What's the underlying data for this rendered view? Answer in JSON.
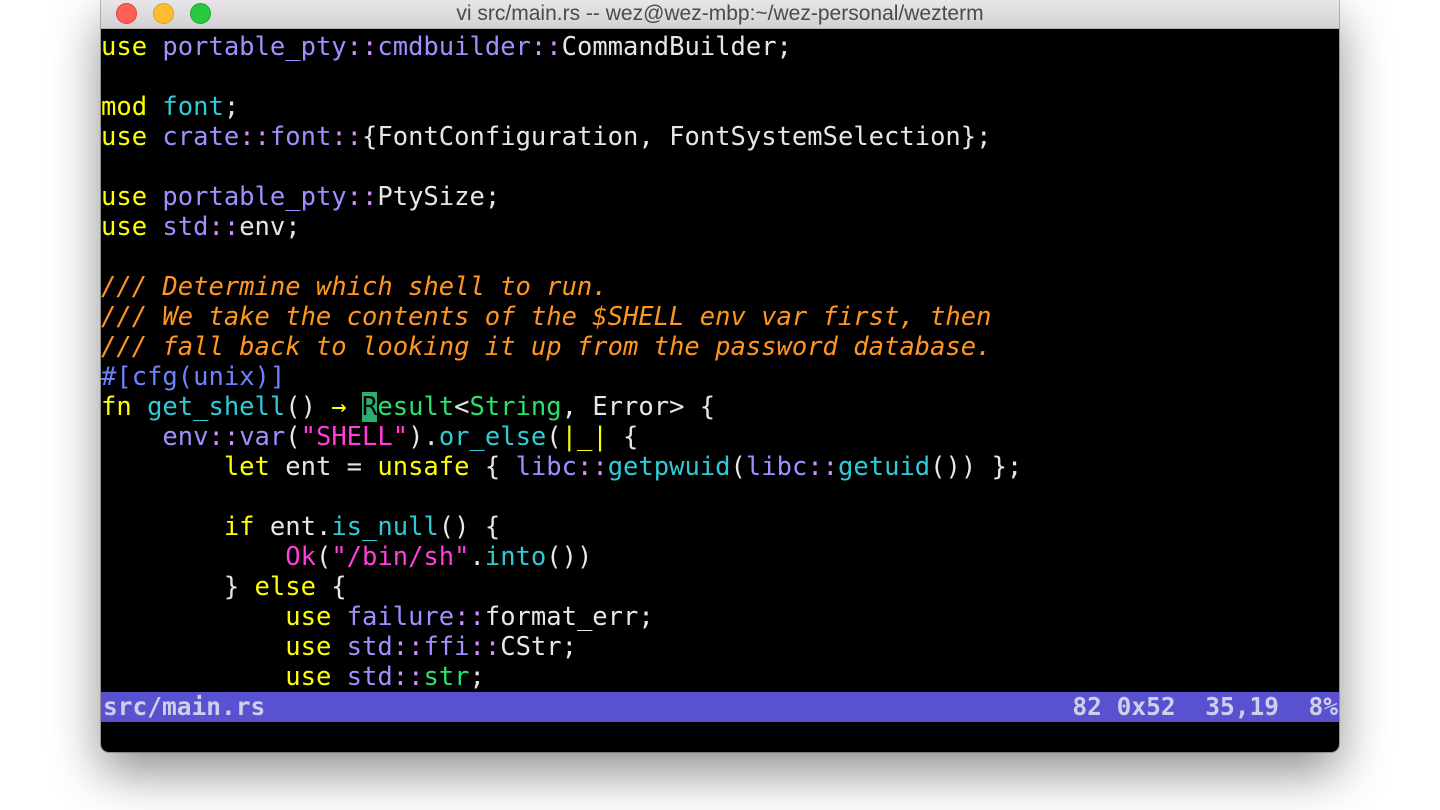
{
  "window": {
    "title": "vi src/main.rs -- wez@wez-mbp:~/wez-personal/wezterm"
  },
  "colors": {
    "keyword": "#ffff00",
    "path": "#9c91ff",
    "separator": "#d68dff",
    "text": "#e6e6e6",
    "module": "#2ecbd6",
    "comment": "#ff9620",
    "attribute": "#6e82ff",
    "function": "#2ecbd6",
    "type": "#29e070",
    "string": "#ff3fd9",
    "constant": "#ff3fd9",
    "cursor_bg": "#2cae6f",
    "statusbar_bg": "#5a51d0"
  },
  "editor": {
    "lines": [
      [
        [
          "keyword",
          "use "
        ],
        [
          "path",
          "portable_pty"
        ],
        [
          "separator",
          "::"
        ],
        [
          "path",
          "cmdbuilder"
        ],
        [
          "separator",
          "::"
        ],
        [
          "text",
          "CommandBuilder;"
        ]
      ],
      [],
      [
        [
          "keyword",
          "mod "
        ],
        [
          "module",
          "font"
        ],
        [
          "text",
          ";"
        ]
      ],
      [
        [
          "keyword",
          "use "
        ],
        [
          "path",
          "crate"
        ],
        [
          "separator",
          "::"
        ],
        [
          "path",
          "font"
        ],
        [
          "separator",
          "::"
        ],
        [
          "text",
          "{FontConfiguration, FontSystemSelection};"
        ]
      ],
      [],
      [
        [
          "keyword",
          "use "
        ],
        [
          "path",
          "portable_pty"
        ],
        [
          "separator",
          "::"
        ],
        [
          "text",
          "PtySize;"
        ]
      ],
      [
        [
          "keyword",
          "use "
        ],
        [
          "path",
          "std"
        ],
        [
          "separator",
          "::"
        ],
        [
          "text",
          "env;"
        ]
      ],
      [],
      [
        [
          "comment",
          "/// Determine which shell to run."
        ]
      ],
      [
        [
          "comment",
          "/// We take the contents of the $SHELL env var first, then"
        ]
      ],
      [
        [
          "comment",
          "/// fall back to looking it up from the password database."
        ]
      ],
      [
        [
          "attribute",
          "#[cfg(unix)]"
        ]
      ],
      [
        [
          "keyword",
          "fn "
        ],
        [
          "function",
          "get_shell"
        ],
        [
          "text",
          "() "
        ],
        [
          "keyword",
          "→ "
        ],
        [
          "cursor",
          "R"
        ],
        [
          "type",
          "esult"
        ],
        [
          "text",
          "<"
        ],
        [
          "type",
          "String"
        ],
        [
          "text",
          ", Error> {"
        ]
      ],
      [
        [
          "text",
          "    "
        ],
        [
          "path",
          "env"
        ],
        [
          "separator",
          "::"
        ],
        [
          "path",
          "var"
        ],
        [
          "text",
          "("
        ],
        [
          "string",
          "\"SHELL\""
        ],
        [
          "text",
          ")."
        ],
        [
          "function",
          "or_else"
        ],
        [
          "text",
          "("
        ],
        [
          "keyword",
          "|_|"
        ],
        [
          "text",
          " {"
        ]
      ],
      [
        [
          "text",
          "        "
        ],
        [
          "keyword",
          "let "
        ],
        [
          "text",
          "ent = "
        ],
        [
          "keyword",
          "unsafe"
        ],
        [
          "text",
          " { "
        ],
        [
          "path",
          "libc"
        ],
        [
          "separator",
          "::"
        ],
        [
          "function",
          "getpwuid"
        ],
        [
          "text",
          "("
        ],
        [
          "path",
          "libc"
        ],
        [
          "separator",
          "::"
        ],
        [
          "function",
          "getuid"
        ],
        [
          "text",
          "()) };"
        ]
      ],
      [],
      [
        [
          "text",
          "        "
        ],
        [
          "keyword",
          "if "
        ],
        [
          "text",
          "ent."
        ],
        [
          "function",
          "is_null"
        ],
        [
          "text",
          "() {"
        ]
      ],
      [
        [
          "text",
          "            "
        ],
        [
          "constant",
          "Ok"
        ],
        [
          "text",
          "("
        ],
        [
          "string",
          "\"/bin/sh\""
        ],
        [
          "text",
          "."
        ],
        [
          "function",
          "into"
        ],
        [
          "text",
          "())"
        ]
      ],
      [
        [
          "text",
          "        } "
        ],
        [
          "keyword",
          "else"
        ],
        [
          "text",
          " {"
        ]
      ],
      [
        [
          "text",
          "            "
        ],
        [
          "keyword",
          "use "
        ],
        [
          "path",
          "failure"
        ],
        [
          "separator",
          "::"
        ],
        [
          "text",
          "format_err;"
        ]
      ],
      [
        [
          "text",
          "            "
        ],
        [
          "keyword",
          "use "
        ],
        [
          "path",
          "std"
        ],
        [
          "separator",
          "::"
        ],
        [
          "path",
          "ffi"
        ],
        [
          "separator",
          "::"
        ],
        [
          "text",
          "CStr;"
        ]
      ],
      [
        [
          "text",
          "            "
        ],
        [
          "keyword",
          "use "
        ],
        [
          "path",
          "std"
        ],
        [
          "separator",
          "::"
        ],
        [
          "type",
          "str"
        ],
        [
          "text",
          ";"
        ]
      ]
    ]
  },
  "statusline": {
    "filename": "src/main.rs",
    "char_code": "82 0x52",
    "position": "35,19",
    "percent": "8%"
  }
}
